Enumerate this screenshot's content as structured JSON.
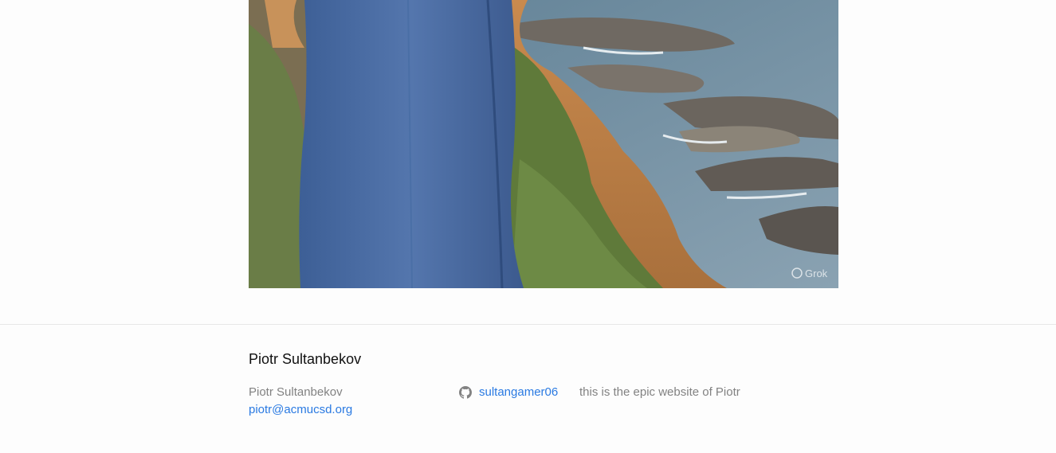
{
  "photo": {
    "alt": "Piotr standing on a cliff above the ocean",
    "watermark": "Grok"
  },
  "footer": {
    "heading": "Piotr Sultanbekov",
    "author_name": "Piotr Sultanbekov",
    "email": "piotr@acmucsd.org",
    "github_username": "sultangamer06",
    "description": "this is the epic website of Piotr"
  },
  "colors": {
    "link": "#2a7ae2",
    "muted": "#828282",
    "background": "#fdfdfd"
  },
  "icons": [
    "github-icon"
  ]
}
